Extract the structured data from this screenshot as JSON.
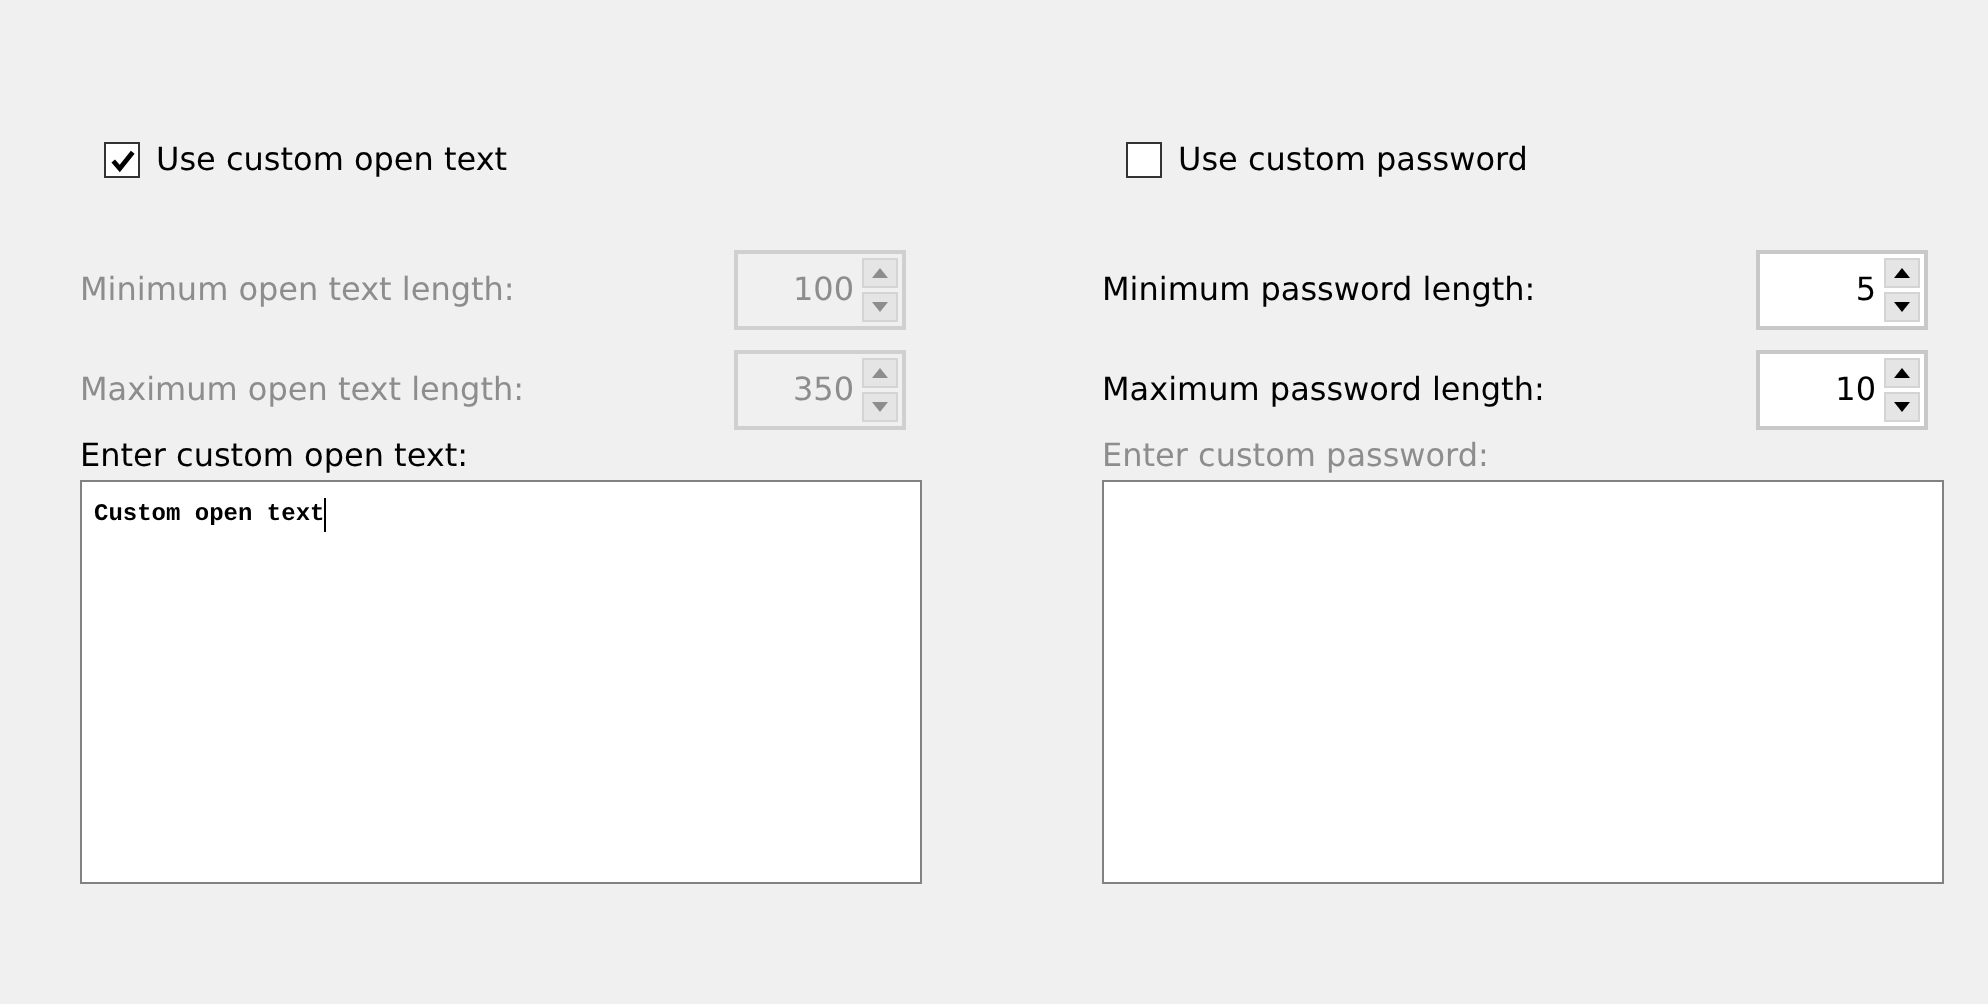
{
  "panels": [
    {
      "checkbox": {
        "label": "Use custom open text",
        "checked": true
      },
      "spinners": [
        {
          "label": "Minimum open text length:",
          "value": "100",
          "disabled": true
        },
        {
          "label": "Maximum open text length:",
          "value": "350",
          "disabled": true
        }
      ],
      "text_label": {
        "text": "Enter custom open text:",
        "disabled": false
      },
      "text_area": {
        "value": "Custom open text",
        "focused": true
      }
    },
    {
      "checkbox": {
        "label": "Use custom password",
        "checked": false
      },
      "spinners": [
        {
          "label": "Minimum password length:",
          "value": "5",
          "disabled": false
        },
        {
          "label": "Maximum password length:",
          "value": "10",
          "disabled": false
        }
      ],
      "text_label": {
        "text": "Enter custom password:",
        "disabled": true
      },
      "text_area": {
        "focused": false
      }
    }
  ]
}
